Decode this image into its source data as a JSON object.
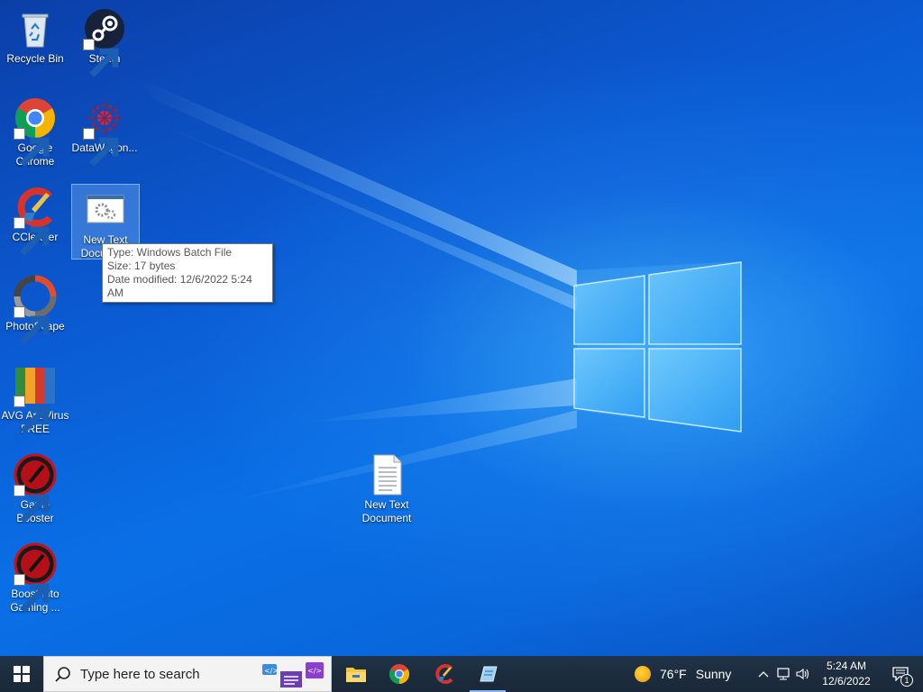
{
  "desktop": {
    "icons": [
      {
        "id": "recycle-bin",
        "label": "Recycle Bin"
      },
      {
        "id": "steam",
        "label": "Steam"
      },
      {
        "id": "google-chrome",
        "label": "Google Chrome"
      },
      {
        "id": "datawagon",
        "label": "DataWagon..."
      },
      {
        "id": "ccleaner",
        "label": "CCleaner"
      },
      {
        "id": "new-text-document-selected",
        "label": "New Text Document"
      },
      {
        "id": "photoscape",
        "label": "PhotoScape"
      },
      {
        "id": "avg-antivirus",
        "label": "AVG AntiVirus FREE"
      },
      {
        "id": "game-booster",
        "label": "Game Booster"
      },
      {
        "id": "boost-into-gaming",
        "label": "Boost into Gaming ..."
      },
      {
        "id": "new-text-document",
        "label": "New Text Document"
      }
    ]
  },
  "tooltip": {
    "type": "Type: Windows Batch File",
    "size": "Size: 17 bytes",
    "modified": "Date modified: 12/6/2022 5:24 AM"
  },
  "taskbar": {
    "search_placeholder": "Type here to search",
    "apps": [
      "file-explorer",
      "google-chrome",
      "ccleaner",
      "notepad-like-app"
    ],
    "weather": {
      "temp": "76°F",
      "condition": "Sunny"
    },
    "clock": {
      "time": "5:24 AM",
      "date": "12/6/2022"
    },
    "notifications_count": "1"
  },
  "colors": {
    "taskbar": "#1c2a3a",
    "desktop_blue": "#0a56c8",
    "selection": "#99ccff"
  }
}
